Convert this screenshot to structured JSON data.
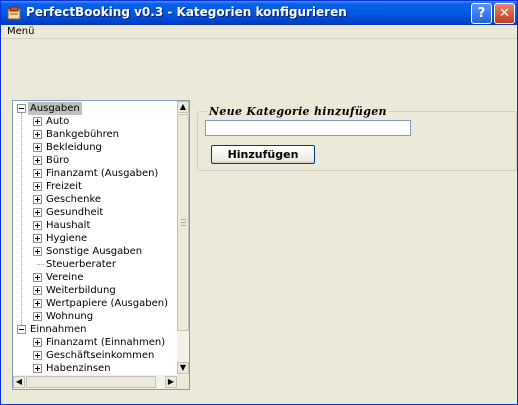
{
  "window": {
    "title": "PerfectBooking v0.3 - Kategorien konfigurieren",
    "help_label": "?",
    "close_label": "✕"
  },
  "menu": {
    "items": [
      "Menü"
    ]
  },
  "tree": {
    "nodes": [
      {
        "label": "Ausgaben",
        "level": 0,
        "expander": "minus",
        "selected": true
      },
      {
        "label": "Auto",
        "level": 1,
        "expander": "plus"
      },
      {
        "label": "Bankgebühren",
        "level": 1,
        "expander": "plus"
      },
      {
        "label": "Bekleidung",
        "level": 1,
        "expander": "plus"
      },
      {
        "label": "Büro",
        "level": 1,
        "expander": "plus"
      },
      {
        "label": "Finanzamt (Ausgaben)",
        "level": 1,
        "expander": "plus"
      },
      {
        "label": "Freizeit",
        "level": 1,
        "expander": "plus"
      },
      {
        "label": "Geschenke",
        "level": 1,
        "expander": "plus"
      },
      {
        "label": "Gesundheit",
        "level": 1,
        "expander": "plus"
      },
      {
        "label": "Haushalt",
        "level": 1,
        "expander": "plus"
      },
      {
        "label": "Hygiene",
        "level": 1,
        "expander": "plus"
      },
      {
        "label": "Sonstige Ausgaben",
        "level": 1,
        "expander": "plus"
      },
      {
        "label": "Steuerberater",
        "level": 1,
        "expander": "none"
      },
      {
        "label": "Vereine",
        "level": 1,
        "expander": "plus"
      },
      {
        "label": "Weiterbildung",
        "level": 1,
        "expander": "plus"
      },
      {
        "label": "Wertpapiere (Ausgaben)",
        "level": 1,
        "expander": "plus"
      },
      {
        "label": "Wohnung",
        "level": 1,
        "expander": "plus"
      },
      {
        "label": "Einnahmen",
        "level": 0,
        "expander": "minus"
      },
      {
        "label": "Finanzamt (Einnahmen)",
        "level": 1,
        "expander": "plus"
      },
      {
        "label": "Geschäftseinkommen",
        "level": 1,
        "expander": "plus"
      },
      {
        "label": "Habenzinsen",
        "level": 1,
        "expander": "plus"
      }
    ]
  },
  "scrollbars": {
    "up_arrow": "▲",
    "down_arrow": "▼",
    "left_arrow": "◀",
    "right_arrow": "▶"
  },
  "new_category": {
    "legend": "Neue Kategorie hinzufügen",
    "input_value": "",
    "add_button_label": "Hinzufügen"
  },
  "colors": {
    "titlebar": "#0058e6",
    "window_bg": "#ece9d8",
    "selected_bg": "#c0c0c0"
  }
}
